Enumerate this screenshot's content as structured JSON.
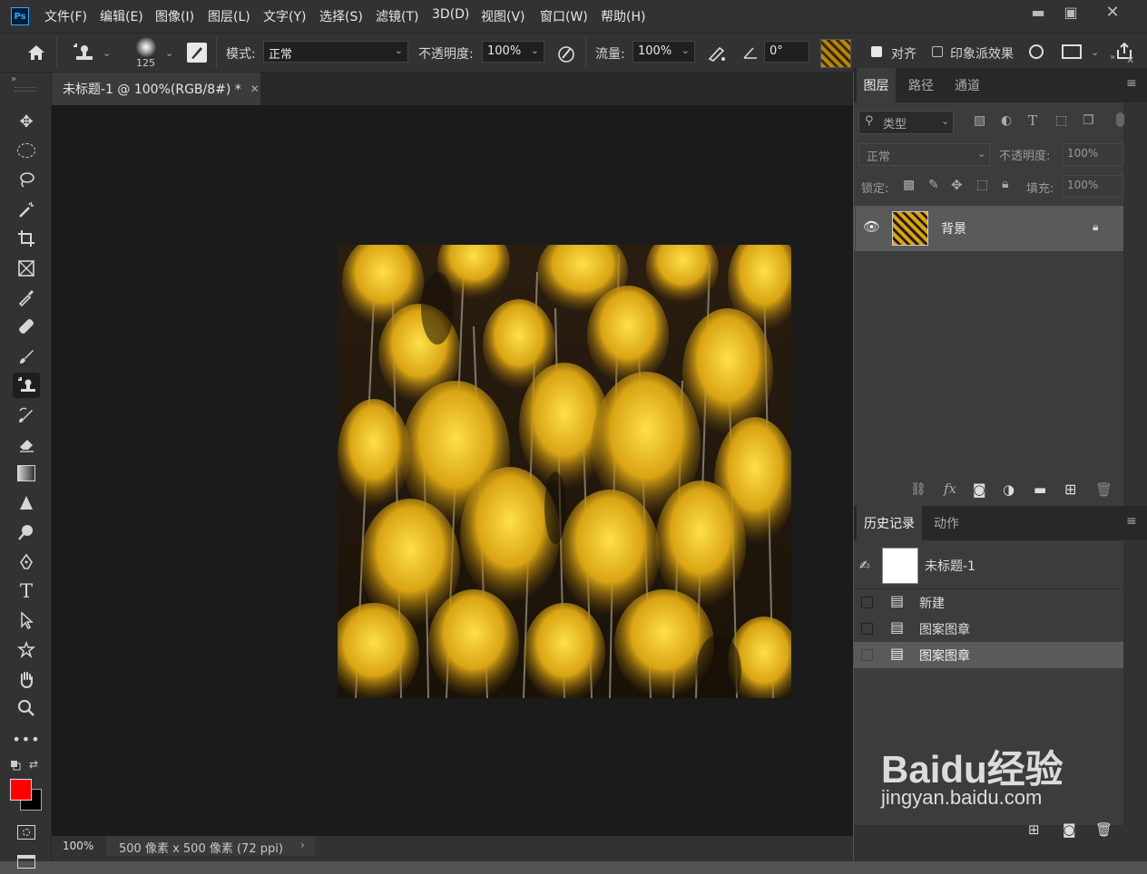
{
  "app": {
    "logo": "Ps"
  },
  "menu": [
    "文件(F)",
    "编辑(E)",
    "图像(I)",
    "图层(L)",
    "文字(Y)",
    "选择(S)",
    "滤镜(T)",
    "3D(D)",
    "视图(V)",
    "窗口(W)",
    "帮助(H)"
  ],
  "window_controls": {
    "minimize": "minimize-icon",
    "maximize": "maximize-icon",
    "close": "close-icon"
  },
  "options": {
    "brush_size": "125",
    "mode_label": "模式:",
    "mode_value": "正常",
    "opacity_label": "不透明度:",
    "opacity_value": "100%",
    "flow_label": "流量:",
    "flow_value": "100%",
    "angle_value": "0°",
    "align_label": "对齐",
    "impressionist_label": "印象派效果"
  },
  "document": {
    "tab_title": "未标题-1 @ 100%(RGB/8#) *",
    "status_zoom": "100%",
    "status_info": "500 像素 x 500 像素 (72 ppi)"
  },
  "layers_panel": {
    "tabs": [
      "图层",
      "路径",
      "通道"
    ],
    "active_tab": "图层",
    "filter_label": "类型",
    "blend_mode": "正常",
    "opacity_label": "不透明度:",
    "opacity_value": "100%",
    "lock_label": "锁定:",
    "fill_label": "填充:",
    "fill_value": "100%",
    "layers": [
      {
        "name": "背景",
        "locked": true,
        "visible": true
      }
    ]
  },
  "history_panel": {
    "tabs": [
      "历史记录",
      "动作"
    ],
    "active_tab": "历史记录",
    "snapshot_name": "未标题-1",
    "items": [
      "新建",
      "图案图章",
      "图案图章"
    ]
  },
  "watermark": {
    "brand": "Baidu经验",
    "url": "jingyan.baidu.com"
  },
  "colors": {
    "foreground": "#ff0000",
    "background": "#000000",
    "canvas": "#1b1b1b",
    "ui": "#323232"
  }
}
